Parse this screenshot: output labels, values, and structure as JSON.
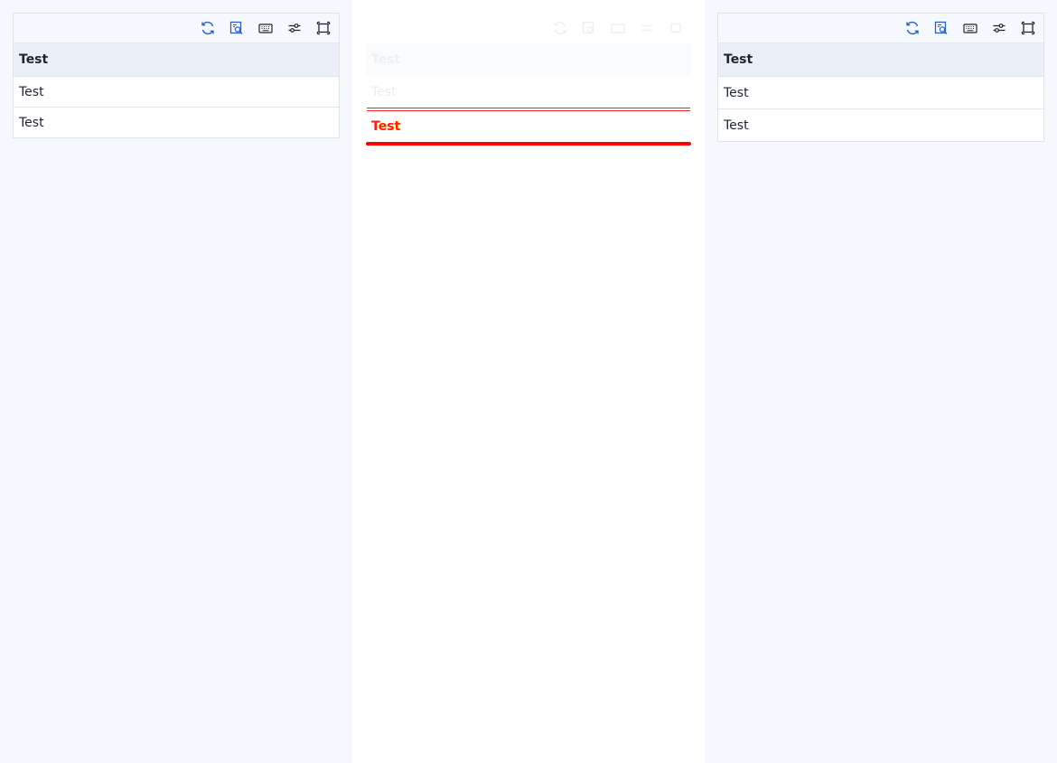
{
  "panels": [
    {
      "id": "left",
      "header": "Test",
      "rows": [
        "Test",
        "Test"
      ]
    },
    {
      "id": "mid",
      "header": "Test",
      "rows": [
        "Test",
        "Test"
      ]
    },
    {
      "id": "right",
      "header": "Test",
      "rows": [
        "Test",
        "Test"
      ]
    }
  ],
  "toolbar_icons": [
    "refresh-icon",
    "search-preview-icon",
    "keyboard-icon",
    "sliders-icon",
    "fullscreen-icon"
  ],
  "colors": {
    "accent": "#2b5fc4",
    "icon_dark": "#1d2433",
    "header_bg": "#ebf0f8",
    "page_bg": "#f5f8fc",
    "diff_red": "#ff0000",
    "diff_yellow": "#ffe000"
  }
}
